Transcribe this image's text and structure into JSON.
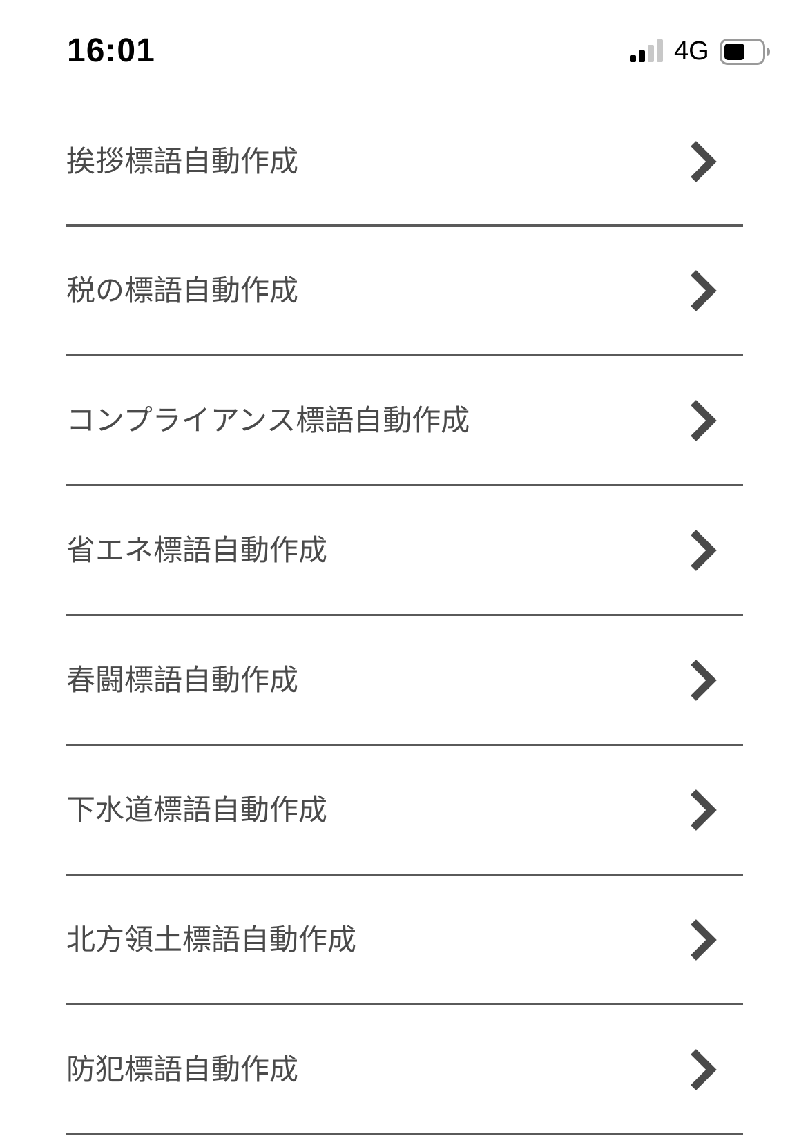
{
  "status_bar": {
    "time": "16:01",
    "network": "4G",
    "signal_icon": "cellular-signal-icon",
    "battery_icon": "battery-icon"
  },
  "menu": {
    "items": [
      {
        "label": "挨拶標語自動作成",
        "icon": "chevron-right-icon"
      },
      {
        "label": "税の標語自動作成",
        "icon": "chevron-right-icon"
      },
      {
        "label": "コンプライアンス標語自動作成",
        "icon": "chevron-right-icon"
      },
      {
        "label": "省エネ標語自動作成",
        "icon": "chevron-right-icon"
      },
      {
        "label": "春闘標語自動作成",
        "icon": "chevron-right-icon"
      },
      {
        "label": "下水道標語自動作成",
        "icon": "chevron-right-icon"
      },
      {
        "label": "北方領土標語自動作成",
        "icon": "chevron-right-icon"
      },
      {
        "label": "防犯標語自動作成",
        "icon": "chevron-right-icon"
      }
    ]
  },
  "colors": {
    "text": "#4a4a4a",
    "divider": "#5a5a5a",
    "chevron": "#4a4a4a",
    "background": "#ffffff"
  }
}
